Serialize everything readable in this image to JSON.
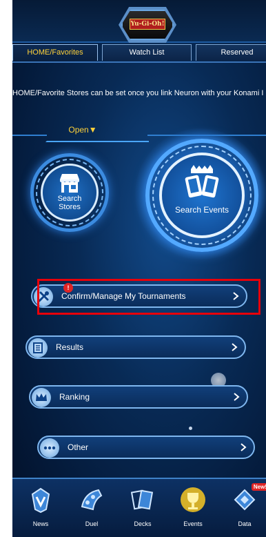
{
  "header": {
    "logo_text": "Yu-Gi-Oh!"
  },
  "tabs": [
    {
      "label": "HOME/Favorites",
      "active": true
    },
    {
      "label": "Watch List",
      "active": false
    },
    {
      "label": "Reserved",
      "active": false
    }
  ],
  "notice": "HOME/Favorite Stores can be set once you link Neuron with your Konami I",
  "open_label": "Open▼",
  "search_stores": {
    "line1": "Search",
    "line2": "Stores",
    "icon": "store-icon"
  },
  "search_events": {
    "label": "Search Events",
    "icon": "cards-icon"
  },
  "menu": {
    "confirm": {
      "label": "Confirm/Manage My Tournaments",
      "badge": "!",
      "icon": "tools-icon"
    },
    "results": {
      "label": "Results",
      "icon": "list-icon"
    },
    "ranking": {
      "label": "Ranking",
      "icon": "crown-icon"
    },
    "other": {
      "label": "Other",
      "icon": "ellipsis-icon"
    }
  },
  "bottom_nav": [
    {
      "label": "News",
      "icon": "news-icon"
    },
    {
      "label": "Duel",
      "icon": "duel-icon"
    },
    {
      "label": "Decks",
      "icon": "decks-icon"
    },
    {
      "label": "Events",
      "icon": "events-icon"
    },
    {
      "label": "Data",
      "icon": "data-icon",
      "badge": "New!"
    }
  ],
  "colors": {
    "accent": "#ffd23a",
    "highlight": "#e8000a",
    "bg": "#082a55"
  }
}
